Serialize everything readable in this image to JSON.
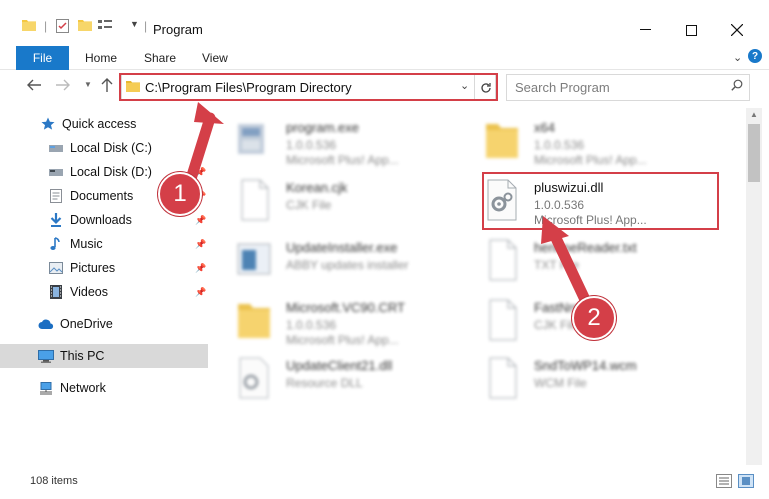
{
  "window": {
    "title": "Program"
  },
  "ribbon": {
    "file": "File",
    "home": "Home",
    "share": "Share",
    "view": "View"
  },
  "address": {
    "path": "C:\\Program Files\\Program Directory"
  },
  "search": {
    "placeholder": "Search Program"
  },
  "sidebar": {
    "items": [
      {
        "label": "Quick access",
        "icon": "star-icon"
      },
      {
        "label": "Local Disk (C:)",
        "icon": "drive-icon"
      },
      {
        "label": "Local Disk (D:)",
        "icon": "drive-icon"
      },
      {
        "label": "Documents",
        "icon": "documents-icon"
      },
      {
        "label": "Downloads",
        "icon": "download-icon"
      },
      {
        "label": "Music",
        "icon": "music-icon"
      },
      {
        "label": "Pictures",
        "icon": "pictures-icon"
      },
      {
        "label": "Videos",
        "icon": "videos-icon"
      },
      {
        "label": "OneDrive",
        "icon": "cloud-icon"
      },
      {
        "label": "This PC",
        "icon": "computer-icon"
      },
      {
        "label": "Network",
        "icon": "network-icon"
      }
    ]
  },
  "files": [
    {
      "name": "program.exe",
      "line2": "1.0.0.536",
      "line3": "Microsoft Plus! App..."
    },
    {
      "name": "x64",
      "line2": "1.0.0.536",
      "line3": "Microsoft Plus! App..."
    },
    {
      "name": "Korean.cjk",
      "line2": "CJK File",
      "line3": ""
    },
    {
      "name": "pluswizui.dll",
      "line2": "1.0.0.536",
      "line3": "Microsoft Plus! App..."
    },
    {
      "name": "UpdateInstaller.exe",
      "line2": "ABBY updates installer",
      "line3": ""
    },
    {
      "name": "henoneReader.txt",
      "line2": "TXT File",
      "line3": ""
    },
    {
      "name": "Microsoft.VC90.CRT",
      "line2": "1.0.0.536",
      "line3": "Microsoft Plus! App..."
    },
    {
      "name": "FastNrm",
      "line2": "CJK File",
      "line3": ""
    },
    {
      "name": "UpdateClient21.dll",
      "line2": "Resource DLL",
      "line3": ""
    },
    {
      "name": "SndToWP14.wcm",
      "line2": "WCM File",
      "line3": ""
    }
  ],
  "status": {
    "count": "108 items"
  },
  "callouts": {
    "one": "1",
    "two": "2"
  },
  "colors": {
    "accent": "#1979ca",
    "highlight": "#d43f48",
    "selected": "#d9d9d9"
  }
}
